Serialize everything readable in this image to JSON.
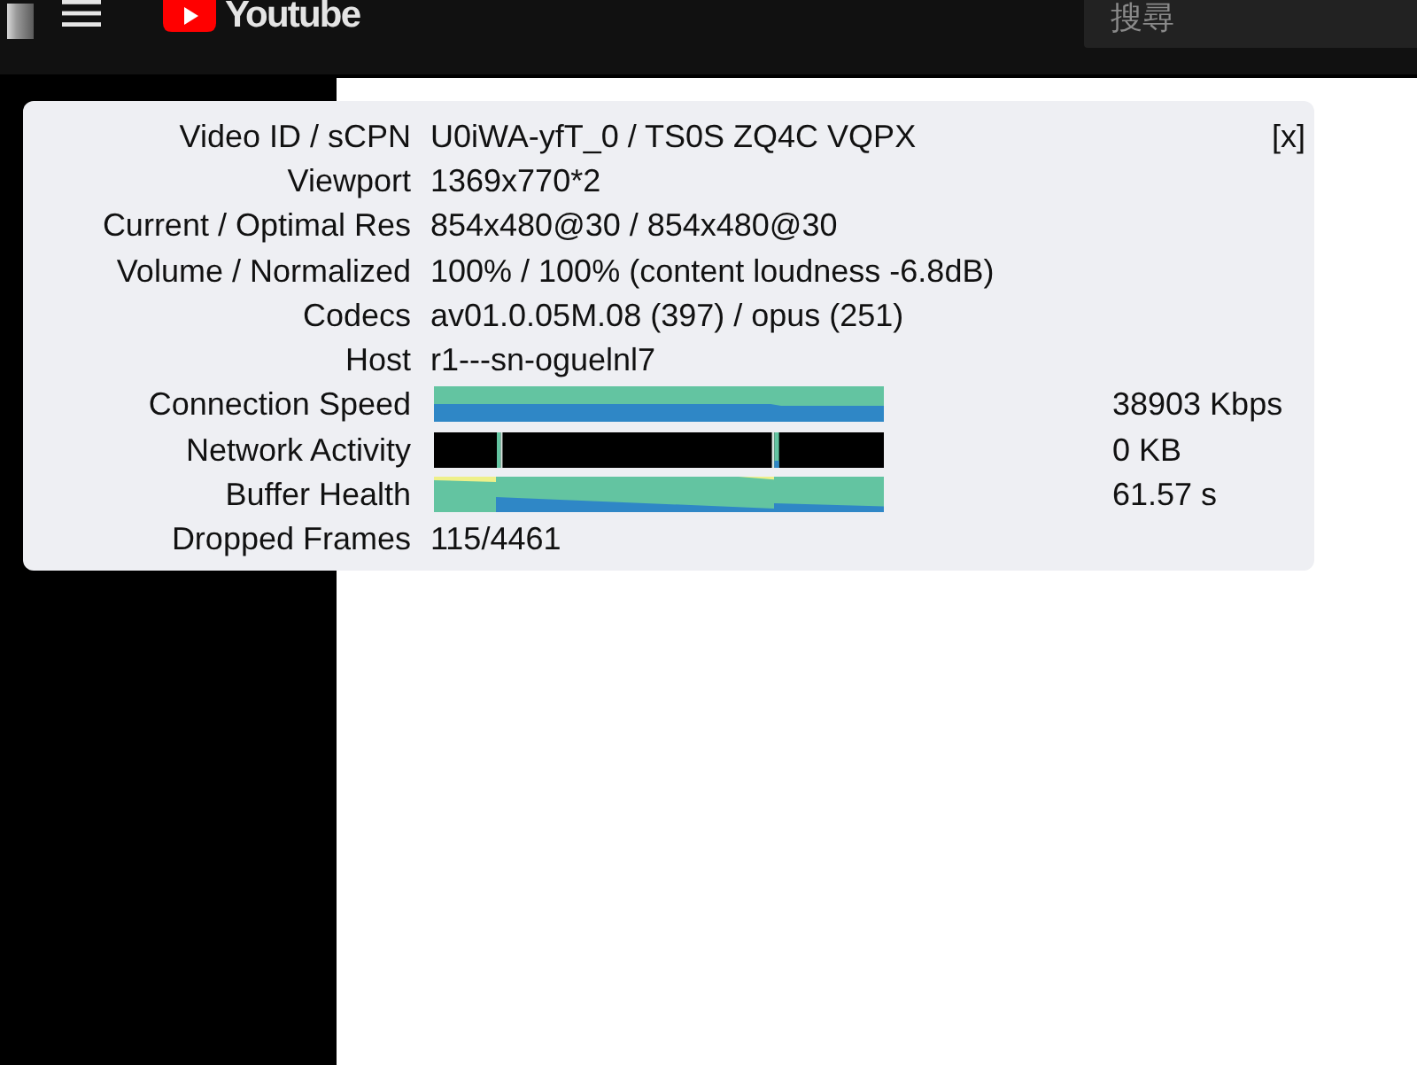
{
  "top_bar": {
    "logo": {
      "text": "Youtube"
    },
    "search": {
      "placeholder": "搜尋"
    }
  },
  "stats_panel": {
    "close_label": "[x]",
    "rows": [
      {
        "kind": "text",
        "label": "Video ID / sCPN",
        "value": "U0iWA-yfT_0 / TS0S ZQ4C VQPX"
      },
      {
        "kind": "text",
        "label": "Viewport",
        "value": "1369x770*2"
      },
      {
        "kind": "text",
        "label": "Current / Optimal Res",
        "value": "854x480@30 / 854x480@30"
      },
      {
        "kind": "text",
        "label": "Volume / Normalized",
        "value": "100% / 100% (content loudness -6.8dB)"
      },
      {
        "kind": "text",
        "label": "Codecs",
        "value": "av01.0.05M.08 (397) / opus (251)"
      },
      {
        "kind": "text",
        "label": "Host",
        "value": "r1---sn-oguelnl7"
      },
      {
        "kind": "speed",
        "label": "Connection Speed",
        "reading": "38903 Kbps"
      },
      {
        "kind": "activity",
        "label": "Network Activity",
        "reading": "0 KB"
      },
      {
        "kind": "buffer",
        "label": "Buffer Health",
        "reading": "61.57 s"
      },
      {
        "kind": "text",
        "label": "Dropped Frames",
        "value": "115/4461"
      }
    ]
  }
}
